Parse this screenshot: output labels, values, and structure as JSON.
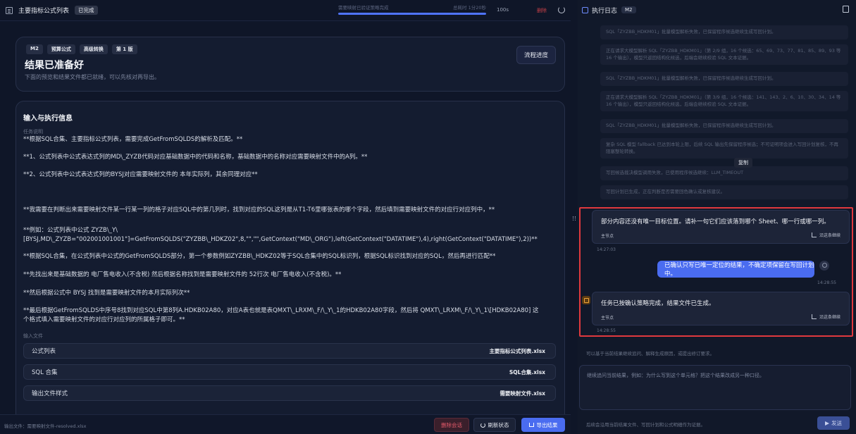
{
  "topbar": {
    "title": "主要指标公式列表",
    "status_badge": "已完成",
    "progress_label_left": "需要映射已验证策略完成",
    "progress_label_right": "总耗时 1分20秒",
    "progress_fraction": 1.0,
    "elapsed": "100s",
    "delete_label": "删除"
  },
  "summary_card": {
    "tags": [
      "M2",
      "预算公式",
      "高级转换",
      "第 1 版"
    ],
    "heading": "结果已准备好",
    "subtitle": "下面的预览和结果文件都已就绪，可以先核对再导出。",
    "flow_button": "流程进度"
  },
  "input_card": {
    "heading": "输入与执行信息",
    "task_label": "任务说明",
    "lines": [
      "**根据SQL合集、主要指标公式列表，需要完成GetFromSQLDS的解析及匹配。**",
      "**1、公式列表中公式表达式列的MD\\_ZYZB代码对应基础数据中的代码和名称，基础数据中的名称对应需要映射文件中的A列。**",
      "**2、公式列表中公式表达式列的BYSJ对应需要映射文件的 本年实际列，其余同理对应**",
      "**我需要在判断出来需要映射文件某一行某一列的格子对应SQL中的第几列时，找到对应的SQL这列是从T1-T6里哪张表的哪个字段，然后填到需要映射文件的对应行对应列中，**",
      "**例如：公式列表中公式 ZYZB\\_Y\\",
      "[BYSJ,MD\\_ZYZB=\"002001001001\"]=GetFromSQLDS(\"ZYZBB\\_HDKZ02\",8,\"\",\"\",GetContext(\"MD\\_ORG\"),left(GetContext(\"DATATIME\"),4),right(GetContext(\"DATATIME\"),2))**",
      "**根据SQL合集，在公式列表中公式的GetFromSQLDS部分，第一个参数例如ZYZBB\\_HDKZ02等于SQL合集中的SQL标识列，根据SQL标识找到对应的SQL，然后再进行匹配**",
      "**先找出来是基础数据的 电厂售电收入(不含税) 然后根据名称找到是需要映射文件的 52行次 电厂售电收入(不含税)。**",
      "**然后根据公式中 BYSJ 找到是需要映射文件的本月实际列次**",
      "**最后根据GetFromSQLDS中序号8找到对应SQL中第8列A.HDKB02A80，对应A表也就是表QMXT\\_LRXM\\_F/\\_Y\\_1的HDKB02A80字段，然后将 QMXT\\_LRXM\\_F/\\_Y\\_1\\[HDKB02A80] 这",
      "个格式填入需要映射文件的对应行对应列的所属格子即可。**"
    ],
    "input_files_label": "输入文件",
    "files": [
      {
        "label": "公式列表",
        "filename": "主要指标公式列表.xlsx"
      },
      {
        "label": "SQL 合集",
        "filename": "SQL合集.xlsx"
      },
      {
        "label": "输出文件样式",
        "filename": "需要映射文件.xlsx"
      }
    ]
  },
  "footer_left": {
    "output_file": "输出文件：需要映射文件-resolved.xlsx",
    "delete_session": "删除会话",
    "refresh_status": "刷新状态",
    "export_result": "导出结果"
  },
  "log_panel": {
    "title": "执行日志",
    "badge": "M2",
    "entries": [
      "SQL「ZYZBB_HDKM01」批量模型解析失败，已保留程序候选继续生成写回计划。",
      "正在请求大模型解析 SQL「ZYZBB_HDKM01」（第 2/9 组，16 个候选：65、69、73、77、81、85、89、93 等 16 个输出），模型只返回结构化候选，后端会继续校验 SQL 文本证据。",
      "SQL「ZYZBB_HDKM01」批量模型解析失败，已保留程序候选继续生成写回计划。",
      "正在请求大模型解析 SQL「ZYZBB_HDKM01」（第 3/9 组，16 个候选：141、143、2、6、10、30、34、14 等 16 个输出），模型只返回结构化候选，后端会继续校验 SQL 文本证据。",
      "SQL「ZYZBB_HDKM01」批量模型解析失败，已保留程序候选继续生成写回计划。",
      "复杂 SQL 模型 fallback 已达到本轮上限，后续 SQL 输出先保留程序候选；不可证明项会进入写回计划复核，不再阻塞整轮转换。",
      "写回候选裁决模型调用失败，已使用程序候选继续：LLM_TIMEOUT",
      "写回计划已生成，正在判断是否需要回色确认或复核建议。"
    ],
    "copy_tooltip": "复制"
  },
  "chat": {
    "assistant_msg1": "部分内容还没有唯一目标位置。请补一句它们应该落到哪个 Sheet、哪一行或哪一列。",
    "node_label": "主节点",
    "continue_label": "沿这条继续",
    "time1": "14:27:03",
    "user_msg": "已确认只写已唯一定位的结果，不确定项保留在写回计划中。",
    "time2": "14:28:55",
    "assistant_msg2": "任务已按确认策略完成，结果文件已生成。",
    "time3": "14:28:55"
  },
  "composer": {
    "hint": "可以基于当前结果继续追问、解释生成原因，或提出修订要求。",
    "placeholder": "继续追问当前结果，例如：为什么写到这个单元格？把这个结果改成另一种口径。",
    "footer_note": "后续会沿用当前结果文件、写回计划和公式明细作为证据。",
    "send_label": "发送"
  }
}
